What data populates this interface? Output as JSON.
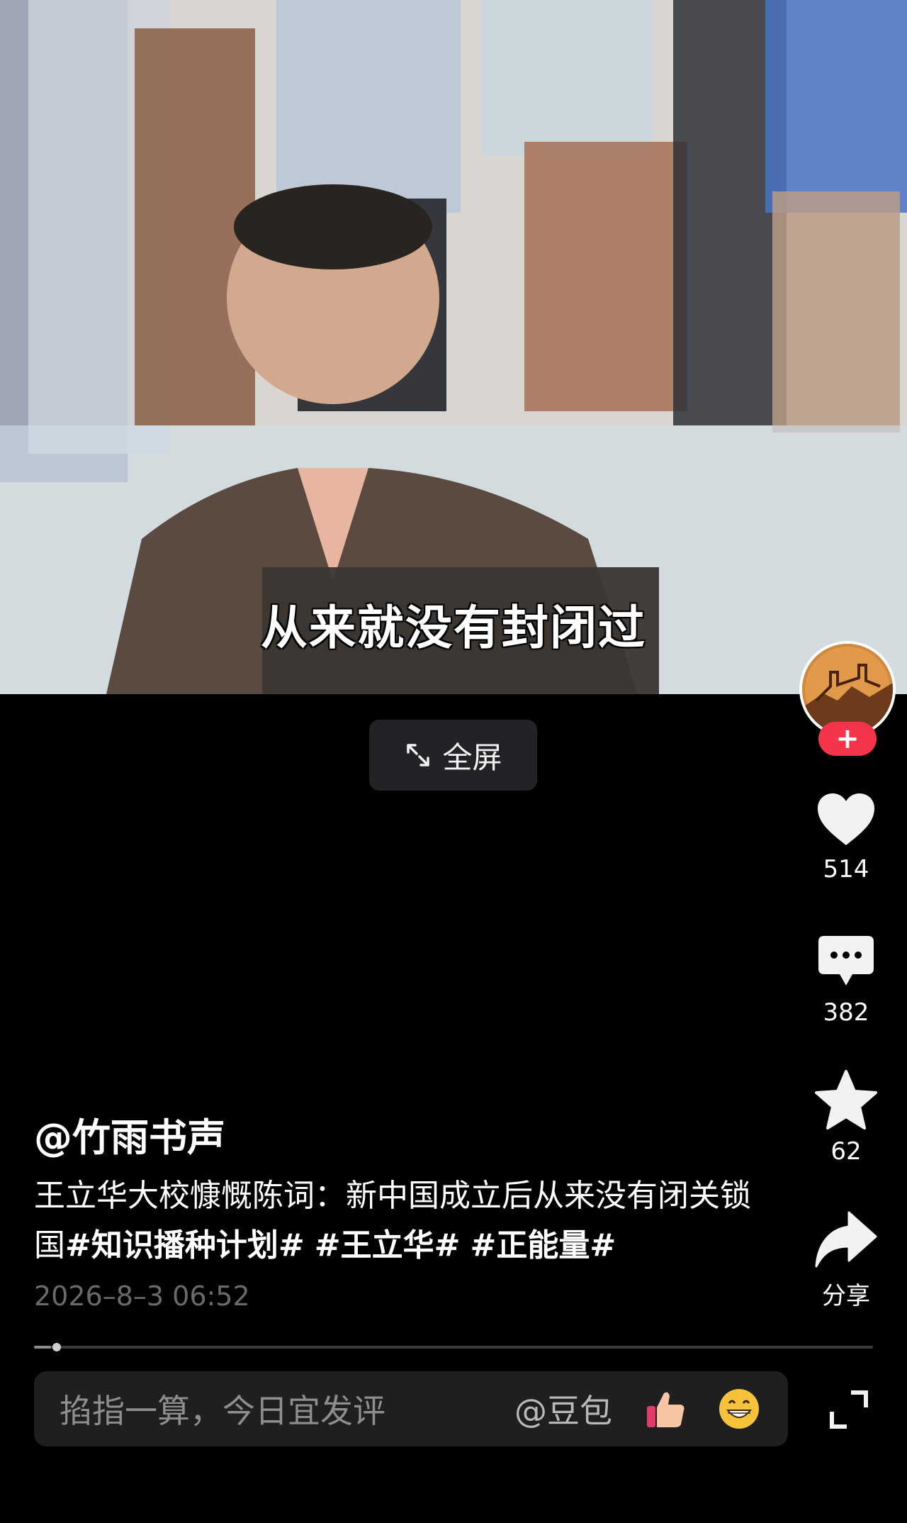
{
  "video": {
    "subtitle": "从来就没有封闭过",
    "fullscreen_label": "全屏"
  },
  "actions": {
    "follow_label": "+",
    "likes": "514",
    "comments": "382",
    "favorites": "62",
    "share_label": "分享"
  },
  "post": {
    "author": "@竹雨书声",
    "caption_text": "王立华大校慷慨陈词：新中国成立后从来没有闭关锁国",
    "tags": [
      "#知识播种计划#",
      "#王立华#",
      "#正能量#"
    ],
    "timestamp": "2026–8–3 06:52"
  },
  "playback": {
    "progress": 0.02
  },
  "comment": {
    "placeholder": "掐指一算，今日宜发评",
    "mention": "@豆包"
  },
  "icons": {
    "fullscreen": "expand-arrows-icon",
    "like": "heart-icon",
    "comment": "speech-bubble-icon",
    "favorite": "star-icon",
    "share": "share-arrow-icon",
    "emoji_1": "thumbs-up-emoji",
    "emoji_2": "grinning-face-emoji",
    "expand": "expand-corners-icon"
  },
  "colors": {
    "follow_accent": "#f3344a",
    "background": "#000000",
    "input_bg": "#1f1f1f"
  }
}
